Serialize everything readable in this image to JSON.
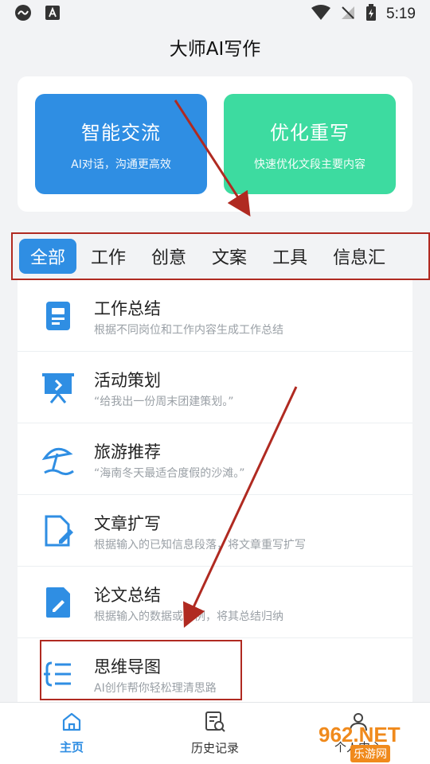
{
  "status_bar": {
    "time": "5:19"
  },
  "app": {
    "title": "大师AI写作"
  },
  "features": [
    {
      "title": "智能交流",
      "subtitle": "AI对话，沟通更高效",
      "color": "#2f8ee3"
    },
    {
      "title": "优化重写",
      "subtitle": "快速优化文段主要内容",
      "color": "#3ddba0"
    }
  ],
  "tabs": [
    {
      "label": "全部",
      "active": true
    },
    {
      "label": "工作"
    },
    {
      "label": "创意"
    },
    {
      "label": "文案"
    },
    {
      "label": "工具"
    },
    {
      "label": "信息汇"
    }
  ],
  "list": [
    {
      "title": "工作总结",
      "desc": "根据不同岗位和工作内容生成工作总结",
      "icon": "document-icon"
    },
    {
      "title": "活动策划",
      "desc": "“给我出一份周末团建策划。”",
      "icon": "presentation-icon"
    },
    {
      "title": "旅游推荐",
      "desc": "“海南冬天最适合度假的沙滩。”",
      "icon": "beach-umbrella-icon"
    },
    {
      "title": "文章扩写",
      "desc": "根据输入的已知信息段落，将文章重写扩写",
      "icon": "file-edit-icon"
    },
    {
      "title": "论文总结",
      "desc": "根据输入的数据或条例，将其总结归纳",
      "icon": "paper-edit-icon"
    },
    {
      "title": "思维导图",
      "desc": "AI创作帮你轻松理清思路",
      "icon": "mind-map-icon"
    }
  ],
  "nav": [
    {
      "label": "主页",
      "active": true,
      "icon": "home-icon"
    },
    {
      "label": "历史记录",
      "icon": "history-icon"
    },
    {
      "label": "个人中心",
      "icon": "profile-icon"
    }
  ],
  "watermark": {
    "text": "962.NET",
    "sub": "乐游网"
  },
  "colors": {
    "accent": "#2f8ee3",
    "green": "#3ddba0",
    "annotation": "#b02a21"
  }
}
